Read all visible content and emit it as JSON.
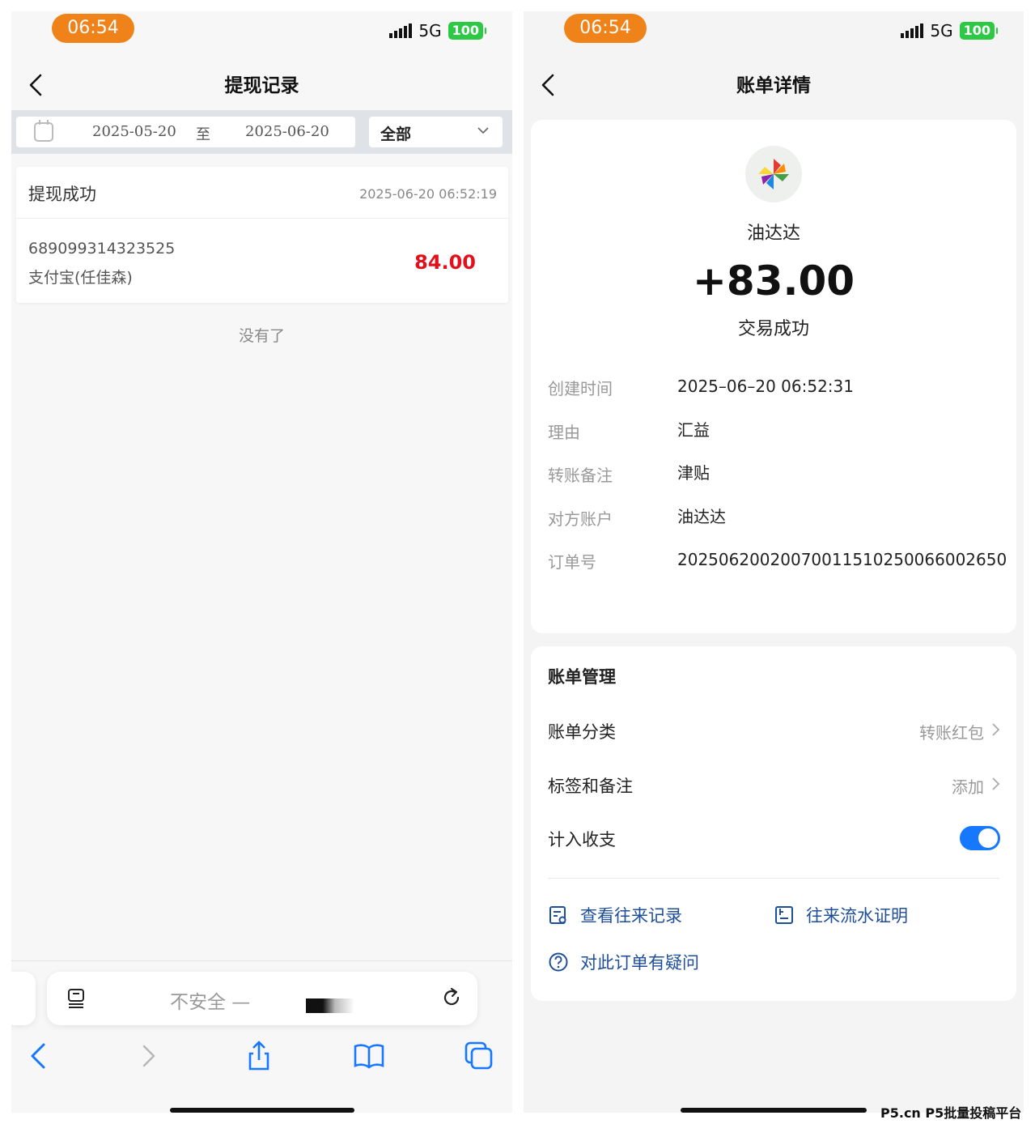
{
  "left": {
    "status": {
      "time": "06:54",
      "network": "5G",
      "battery": "100"
    },
    "nav": {
      "title": "提现记录"
    },
    "filter": {
      "start_date": "2025-05-20",
      "separator": "至",
      "end_date": "2025-06-20",
      "type_selected": "全部"
    },
    "record": {
      "status": "提现成功",
      "time": "2025-06-20 06:52:19",
      "number": "689099314323525",
      "account": "支付宝(任佳森)",
      "amount": "84.00"
    },
    "end_text": "没有了",
    "browser": {
      "url_text": "不安全 —",
      "toolbar_icons": [
        "back-icon",
        "forward-icon",
        "share-icon",
        "bookmarks-icon",
        "tabs-icon"
      ]
    }
  },
  "right": {
    "status": {
      "time": "06:54",
      "network": "5G",
      "battery": "100"
    },
    "nav": {
      "title": "账单详情"
    },
    "summary": {
      "merchant": "油达达",
      "amount": "+83.00",
      "result": "交易成功"
    },
    "details": [
      {
        "label": "创建时间",
        "value": "2025–06–20 06:52:31"
      },
      {
        "label": "理由",
        "value": "汇益"
      },
      {
        "label": "转账备注",
        "value": "津贴"
      },
      {
        "label": "对方账户",
        "value": "油达达"
      },
      {
        "label": "订单号",
        "value": "20250620020070011510250066002650"
      }
    ],
    "manage": {
      "title": "账单管理",
      "category_label": "账单分类",
      "category_value": "转账红包",
      "tags_label": "标签和备注",
      "tags_value": "添加",
      "include_label": "计入收支",
      "include_on": true
    },
    "links": {
      "records": "查看往来记录",
      "proof": "往来流水证明",
      "question": "对此订单有疑问"
    }
  },
  "watermark": "P5.cn P5批量投稿平台",
  "colors": {
    "accent_blue": "#1677ff",
    "link_blue": "#1f4f9a",
    "amount_red": "#e1101c",
    "time_pill": "#f0821a",
    "battery_green": "#2dc945"
  }
}
